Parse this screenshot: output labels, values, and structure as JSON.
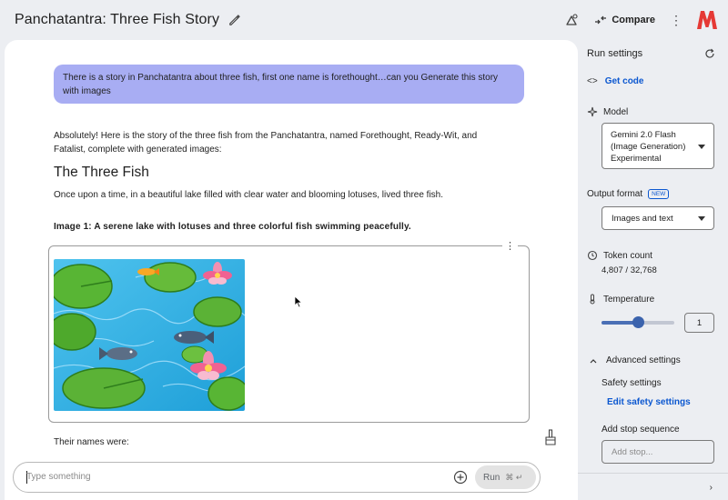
{
  "header": {
    "title": "Panchatantra: Three Fish Story",
    "compare_label": "Compare"
  },
  "chat": {
    "user_message": "There is a story in Panchatantra about three fish, first one name is forethought…can you  Generate this story with images",
    "response_intro": "Absolutely! Here is the story of the three fish from the Panchatantra, named Forethought, Ready-Wit, and Fatalist, complete with generated images:",
    "response_heading": "The Three Fish",
    "response_paragraph": "Once upon a time, in a beautiful lake filled with clear water and blooming lotuses, lived three fish.",
    "image_caption": "Image 1: A serene lake with lotuses and three colorful fish swimming peacefully.",
    "names_line": "Their names were:"
  },
  "input": {
    "placeholder": "Type something",
    "run_label": "Run",
    "run_shortcut": "⌘ ↵"
  },
  "run_settings": {
    "title": "Run settings",
    "get_code": "Get code",
    "model_label": "Model",
    "model_value": "Gemini 2.0 Flash (Image Generation) Experimental",
    "output_format_label": "Output format",
    "output_format_badge": "NEW",
    "output_format_value": "Images and text",
    "token_count_label": "Token count",
    "token_count_value": "4,807 / 32,768",
    "temperature_label": "Temperature",
    "temperature_value": "1",
    "temperature_fraction": 0.5,
    "advanced_label": "Advanced settings",
    "safety_label": "Safety settings",
    "safety_link": "Edit safety settings",
    "stop_sequence_label": "Add stop sequence",
    "stop_placeholder": "Add stop..."
  },
  "colors": {
    "accent_blue": "#0b57d0",
    "user_bubble": "#a8adf3",
    "logo_red": "#e53935",
    "background": "#eceef2"
  }
}
